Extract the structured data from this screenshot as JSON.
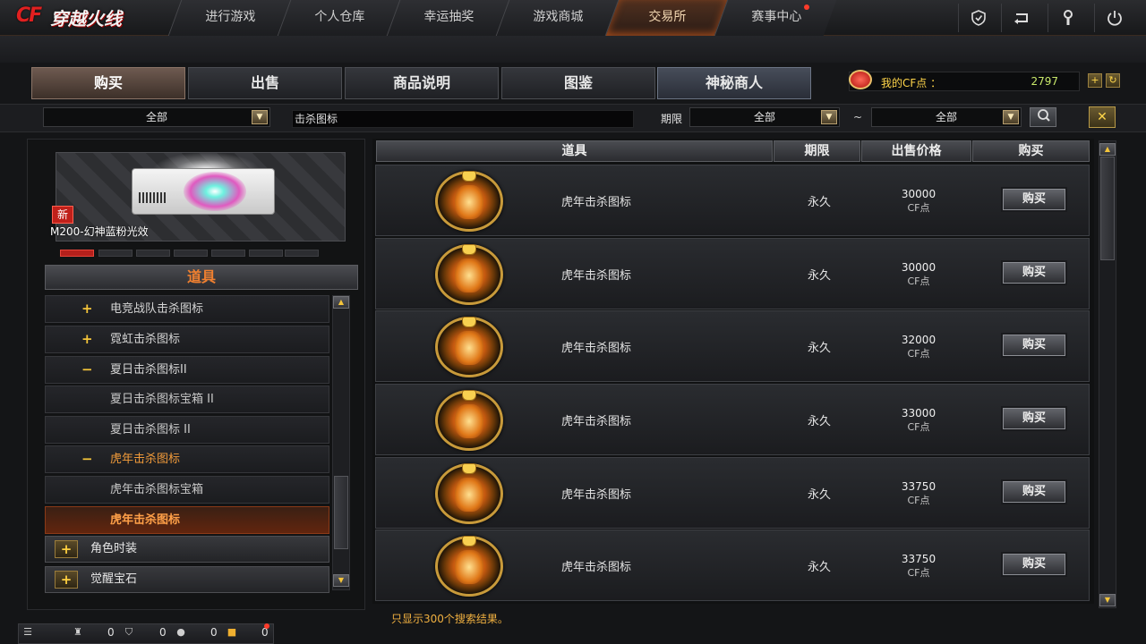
{
  "logo": {
    "cf": "CF",
    "cn": "穿越火线"
  },
  "nav": {
    "tabs": [
      {
        "label": "进行游戏"
      },
      {
        "label": "个人仓库"
      },
      {
        "label": "幸运抽奖"
      },
      {
        "label": "游戏商城"
      },
      {
        "label": "交易所"
      },
      {
        "label": "赛事中心"
      }
    ],
    "active": "交易所",
    "icons": [
      "shield-icon",
      "back-icon",
      "wrench-icon",
      "power-icon"
    ]
  },
  "main_tabs": [
    {
      "label": "购买"
    },
    {
      "label": "出售"
    },
    {
      "label": "商品说明"
    },
    {
      "label": "图鉴"
    },
    {
      "label": "神秘商人"
    }
  ],
  "cf_points": {
    "label": "我的CF点 ：",
    "value": "2797"
  },
  "filters": {
    "category": "全部",
    "search": "击杀图标",
    "period_label": "期限",
    "period_from": "全部",
    "tilde": "~",
    "period_to": "全部"
  },
  "banner": {
    "new_badge": "新",
    "title": "M200-幻神蓝粉光效"
  },
  "pager": {
    "count": 7,
    "active": 0
  },
  "left": {
    "header": "道具",
    "tree": [
      {
        "sign": "+",
        "label": "电竞战队击杀图标"
      },
      {
        "sign": "+",
        "label": "霓虹击杀图标"
      },
      {
        "sign": "−",
        "label": "夏日击杀图标II"
      },
      {
        "sign": "",
        "label": "夏日击杀图标宝箱 II"
      },
      {
        "sign": "",
        "label": "夏日击杀图标 II"
      },
      {
        "sign": "−",
        "label": "虎年击杀图标"
      },
      {
        "sign": "",
        "label": "虎年击杀图标宝箱"
      },
      {
        "sign": "",
        "label": "虎年击杀图标"
      }
    ],
    "categories": [
      {
        "label": "角色时装"
      },
      {
        "label": "觉醒宝石"
      }
    ]
  },
  "table": {
    "headers": {
      "item": "道具",
      "period": "期限",
      "price": "出售价格",
      "buy": "购买"
    },
    "rows": [
      {
        "name": "虎年击杀图标",
        "period": "永久",
        "price": "30000",
        "unit": "CF点",
        "buy": "购买"
      },
      {
        "name": "虎年击杀图标",
        "period": "永久",
        "price": "30000",
        "unit": "CF点",
        "buy": "购买"
      },
      {
        "name": "虎年击杀图标",
        "period": "永久",
        "price": "32000",
        "unit": "CF点",
        "buy": "购买"
      },
      {
        "name": "虎年击杀图标",
        "period": "永久",
        "price": "33000",
        "unit": "CF点",
        "buy": "购买"
      },
      {
        "name": "虎年击杀图标",
        "period": "永久",
        "price": "33750",
        "unit": "CF点",
        "buy": "购买"
      },
      {
        "name": "虎年击杀图标",
        "period": "永久",
        "price": "33750",
        "unit": "CF点",
        "buy": "购买"
      }
    ]
  },
  "result_note": "只显示300个搜索结果。",
  "bottom": {
    "stats": [
      "0",
      "0",
      "0",
      "0"
    ]
  }
}
